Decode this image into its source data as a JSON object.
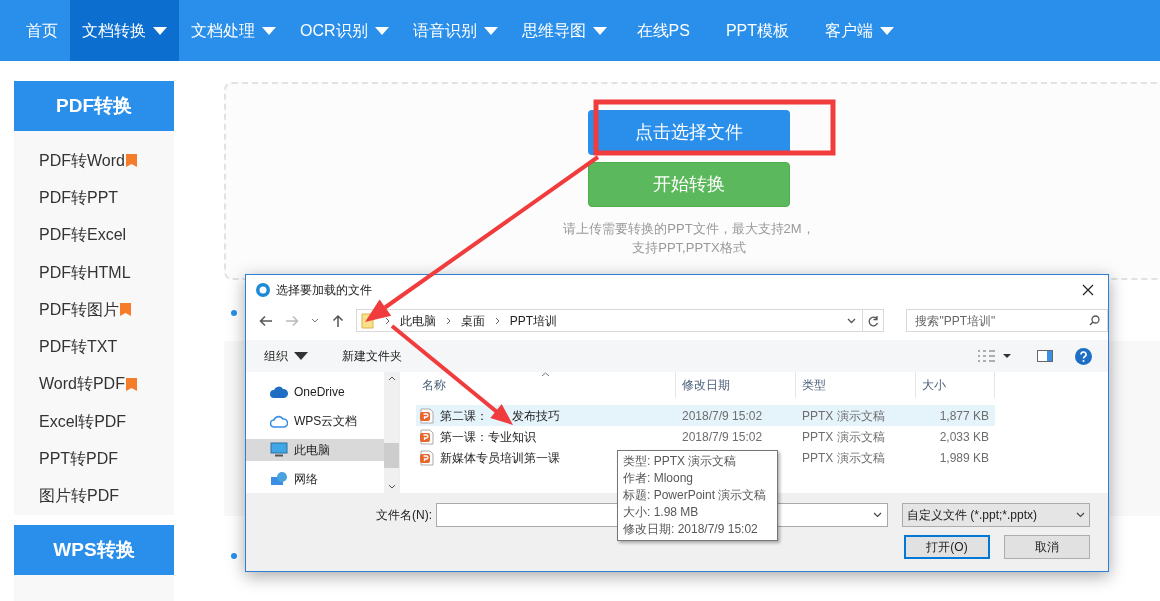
{
  "nav": [
    {
      "label": "首页",
      "dropdown": false,
      "selected": false
    },
    {
      "label": "文档转换",
      "dropdown": true,
      "selected": true
    },
    {
      "label": "文档处理",
      "dropdown": true,
      "selected": false
    },
    {
      "label": "OCR识别",
      "dropdown": true,
      "selected": false
    },
    {
      "label": "语音识别",
      "dropdown": true,
      "selected": false
    },
    {
      "label": "思维导图",
      "dropdown": true,
      "selected": false
    },
    {
      "label": "在线PS",
      "dropdown": false,
      "selected": false
    },
    {
      "label": "PPT模板",
      "dropdown": false,
      "selected": false
    },
    {
      "label": "客户端",
      "dropdown": true,
      "selected": false
    }
  ],
  "sidebar": {
    "sections": [
      {
        "title": "PDF转换",
        "items": [
          {
            "label": "PDF转Word",
            "recommended": true
          },
          {
            "label": "PDF转PPT",
            "recommended": false
          },
          {
            "label": "PDF转Excel",
            "recommended": false
          },
          {
            "label": "PDF转HTML",
            "recommended": false
          },
          {
            "label": "PDF转图片",
            "recommended": true
          },
          {
            "label": "PDF转TXT",
            "recommended": false
          },
          {
            "label": "Word转PDF",
            "recommended": true
          },
          {
            "label": "Excel转PDF",
            "recommended": false
          },
          {
            "label": "PPT转PDF",
            "recommended": false
          },
          {
            "label": "图片转PDF",
            "recommended": false
          }
        ]
      },
      {
        "title": "WPS转换"
      }
    ]
  },
  "upload": {
    "select_button": "点击选择文件",
    "convert_button": "开始转换",
    "hint_lines": [
      "请上传需要转换的PPT文件，最大支持2M，",
      "支持PPT,PPTX格式"
    ]
  },
  "dialog": {
    "title": "选择要加载的文件",
    "breadcrumbs": [
      "此电脑",
      "桌面",
      "PPT培训"
    ],
    "search": {
      "placeholder": "搜索\"PPT培训\""
    },
    "toolbar": {
      "organize": "组织",
      "new_folder": "新建文件夹"
    },
    "nav_pane": [
      {
        "label": "OneDrive",
        "kind": "cloud",
        "selected": false
      },
      {
        "label": "WPS云文档",
        "kind": "cloud-outline",
        "selected": false
      },
      {
        "label": "此电脑",
        "kind": "computer",
        "selected": true
      },
      {
        "label": "网络",
        "kind": "network",
        "selected": false
      }
    ],
    "columns": [
      "名称",
      "修改日期",
      "类型",
      "大小"
    ],
    "files": [
      {
        "name": "第二课：",
        "name_rest": "发布技巧",
        "modified": "2018/7/9 15:02",
        "type": "PPTX 演示文稿",
        "size": "1,877 KB",
        "selected": true
      },
      {
        "name": "第一课：专业知识",
        "modified": "2018/7/9 15:02",
        "type": "PPTX 演示文稿",
        "size": "2,033 KB",
        "selected": false
      },
      {
        "name": "新媒体专员培训第一课",
        "type": "PPTX 演示文稿",
        "size": "1,989 KB",
        "selected": false
      }
    ],
    "filename_label": "文件名(N):",
    "file_type": "自定义文件 (*.ppt;*.pptx)",
    "buttons": [
      {
        "label": "打开(O)",
        "kind": "primary"
      },
      {
        "label": "取消",
        "kind": "default"
      }
    ],
    "tooltip": [
      "类型: PPTX 演示文稿",
      "作者: Mloong",
      "标题: PowerPoint 演示文稿",
      "大小: 1.98 MB",
      "修改日期: 2018/7/9 15:02"
    ]
  }
}
